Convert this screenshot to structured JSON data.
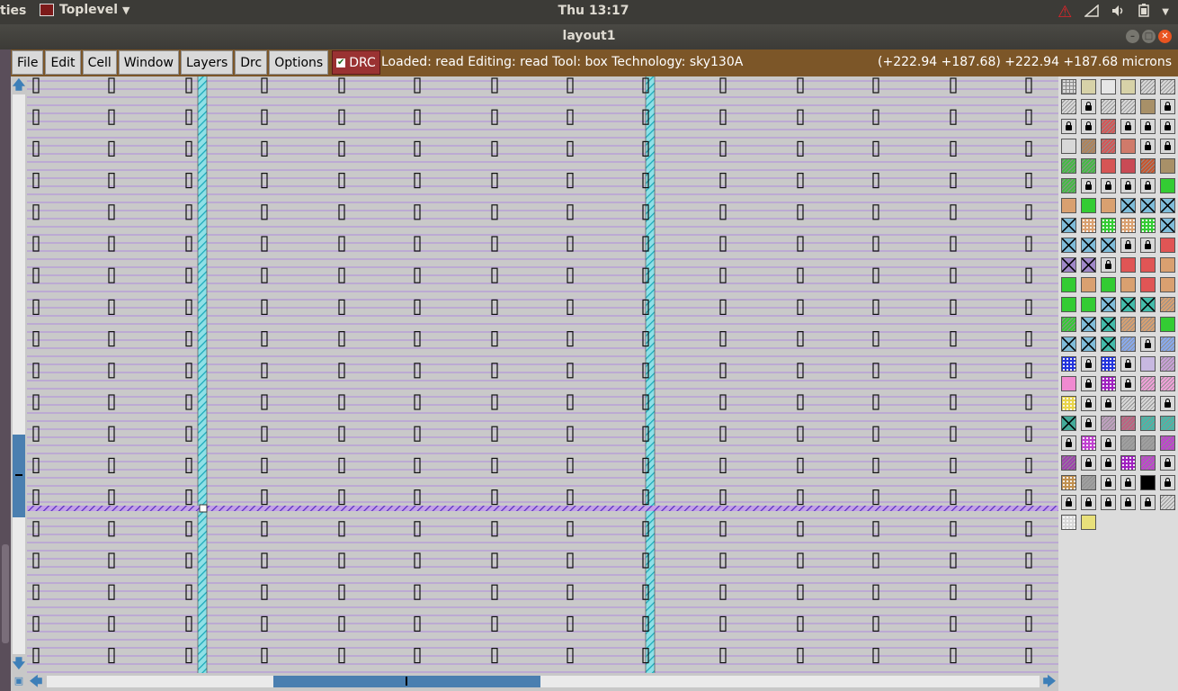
{
  "system_bar": {
    "activities": "ties",
    "app_name": "Toplevel",
    "clock": "Thu 13:17"
  },
  "window": {
    "title": "layout1"
  },
  "menu": {
    "items": [
      "File",
      "Edit",
      "Cell",
      "Window",
      "Layers",
      "Drc",
      "Options"
    ],
    "drc_label": "DRC",
    "drc_checked": true
  },
  "status": {
    "text": "Loaded: read Editing: read Tool: box  Technology: sky130A",
    "coords": "(+222.94 +187.68) +222.94 +187.68 microns"
  },
  "scroll": {
    "vertical_position": 0.64,
    "horizontal_position": 0.4
  },
  "colors": {
    "menubar": "#7c5628",
    "drc_button": "#9a3232",
    "canvas": "#c9c9c9",
    "stripe": "#b9a3d6",
    "via_column": "#29b5c4",
    "selection_line": "#7a3fd0",
    "scroll_thumb": "#4a7fb0"
  },
  "layers": [
    {
      "color": "#d8d8d8",
      "pattern": "grid"
    },
    {
      "color": "#d7d2a8"
    },
    {
      "color": "#e6e6e6",
      "pattern": "outline"
    },
    {
      "color": "#d7d2a8"
    },
    {
      "color": "#d8d8d8",
      "pattern": "hatch"
    },
    {
      "color": "#d8d8d8",
      "pattern": "hatch"
    },
    {
      "color": "#d8d8d8",
      "pattern": "hatch"
    },
    {
      "color": "#d8d8d8",
      "lock": true
    },
    {
      "color": "#d8d8d8",
      "pattern": "hatch"
    },
    {
      "color": "#d8d8d8",
      "pattern": "hatch"
    },
    {
      "color": "#a89068"
    },
    {
      "color": "#d8d8d8",
      "lock": true
    },
    {
      "color": "#d8d8d8",
      "lock": true
    },
    {
      "color": "#d8d8d8",
      "lock": true
    },
    {
      "color": "#d65555",
      "pattern": "hatch"
    },
    {
      "color": "#d8d8d8",
      "lock": true
    },
    {
      "color": "#d8d8d8",
      "lock": true
    },
    {
      "color": "#d8d8d8",
      "lock": true
    },
    {
      "color": "#d8d8d8"
    },
    {
      "color": "#b0845a",
      "pattern": "hatch"
    },
    {
      "color": "#d65555",
      "pattern": "hatch"
    },
    {
      "color": "#d07a6a"
    },
    {
      "color": "#d8d8d8",
      "lock": true
    },
    {
      "color": "#d8d8d8",
      "lock": true
    },
    {
      "color": "#44bb44",
      "pattern": "hatch"
    },
    {
      "color": "#44bb44",
      "pattern": "hatch"
    },
    {
      "color": "#d65555"
    },
    {
      "color": "#c94a55"
    },
    {
      "color": "#c9552d",
      "pattern": "hatch"
    },
    {
      "color": "#a89068"
    },
    {
      "color": "#44bb44",
      "pattern": "hatch"
    },
    {
      "color": "#d8d8d8",
      "lock": true
    },
    {
      "color": "#d8d8d8",
      "lock": true
    },
    {
      "color": "#d8d8d8",
      "lock": true
    },
    {
      "color": "#d8d8d8",
      "lock": true
    },
    {
      "color": "#33cc33"
    },
    {
      "color": "#d9a070"
    },
    {
      "color": "#33cc33"
    },
    {
      "color": "#d9a070"
    },
    {
      "color": "#7fbcd9",
      "pattern": "x"
    },
    {
      "color": "#7fbcd9",
      "pattern": "x"
    },
    {
      "color": "#7fbcd9",
      "pattern": "x"
    },
    {
      "color": "#7fbcd9",
      "pattern": "x"
    },
    {
      "color": "#d9a070",
      "pattern": "dots"
    },
    {
      "color": "#33cc33",
      "pattern": "dots"
    },
    {
      "color": "#d9a070",
      "pattern": "dots"
    },
    {
      "color": "#33cc33",
      "pattern": "dots"
    },
    {
      "color": "#7fbcd9",
      "pattern": "x"
    },
    {
      "color": "#7fbcd9",
      "pattern": "x"
    },
    {
      "color": "#7fbcd9",
      "pattern": "x"
    },
    {
      "color": "#7fbcd9",
      "pattern": "x"
    },
    {
      "color": "#d8d8d8",
      "lock": true
    },
    {
      "color": "#d8d8d8",
      "lock": true
    },
    {
      "color": "#e05555"
    },
    {
      "color": "#a088c8",
      "pattern": "x"
    },
    {
      "color": "#a088c8",
      "pattern": "x"
    },
    {
      "color": "#d8d8d8",
      "lock": true
    },
    {
      "color": "#e05555"
    },
    {
      "color": "#e05555"
    },
    {
      "color": "#d9a070"
    },
    {
      "color": "#33cc33"
    },
    {
      "color": "#d9a070"
    },
    {
      "color": "#33cc33"
    },
    {
      "color": "#d9a070"
    },
    {
      "color": "#e05555"
    },
    {
      "color": "#d9a070"
    },
    {
      "color": "#33cc33"
    },
    {
      "color": "#33cc33"
    },
    {
      "color": "#7fbcd9",
      "pattern": "x"
    },
    {
      "color": "#44bbaa",
      "pattern": "x"
    },
    {
      "color": "#44bbaa",
      "pattern": "x"
    },
    {
      "color": "#d9a070",
      "pattern": "hatch"
    },
    {
      "color": "#33cc33",
      "pattern": "hatch"
    },
    {
      "color": "#7fbcd9",
      "pattern": "x"
    },
    {
      "color": "#44bbaa",
      "pattern": "x"
    },
    {
      "color": "#d9a070",
      "pattern": "hatch"
    },
    {
      "color": "#d9a070",
      "pattern": "hatch"
    },
    {
      "color": "#33cc33"
    },
    {
      "color": "#7fbcd9",
      "pattern": "x"
    },
    {
      "color": "#7fbcd9",
      "pattern": "x"
    },
    {
      "color": "#44bbaa",
      "pattern": "x"
    },
    {
      "color": "#88aaee",
      "pattern": "hatch"
    },
    {
      "color": "#d8d8d8",
      "lock": true
    },
    {
      "color": "#88aaee",
      "pattern": "hatch"
    },
    {
      "color": "#2233dd",
      "pattern": "dots"
    },
    {
      "color": "#d8d8d8",
      "lock": true
    },
    {
      "color": "#2233dd",
      "pattern": "dots"
    },
    {
      "color": "#d8d8d8",
      "lock": true
    },
    {
      "color": "#c7b8e0"
    },
    {
      "color": "#c9a0d8",
      "pattern": "hatch"
    },
    {
      "color": "#f08ad0"
    },
    {
      "color": "#d8d8d8",
      "lock": true
    },
    {
      "color": "#a020c0",
      "pattern": "dots"
    },
    {
      "color": "#d8d8d8",
      "lock": true
    },
    {
      "color": "#f0a0d8",
      "pattern": "hatch"
    },
    {
      "color": "#f0a0d8",
      "pattern": "hatch"
    },
    {
      "color": "#e8d44a",
      "pattern": "dots"
    },
    {
      "color": "#d8d8d8",
      "lock": true
    },
    {
      "color": "#d8d8d8",
      "lock": true
    },
    {
      "color": "#d8d8d8",
      "pattern": "hatch"
    },
    {
      "color": "#d8d8d8",
      "pattern": "hatch"
    },
    {
      "color": "#d8d8d8",
      "lock": true
    },
    {
      "color": "#44aa99",
      "pattern": "x"
    },
    {
      "color": "#d8d8d8",
      "lock": true
    },
    {
      "color": "#c0a0c0",
      "pattern": "hatch"
    },
    {
      "color": "#c06080",
      "pattern": "hatch"
    },
    {
      "color": "#44bbaa",
      "pattern": "hatch"
    },
    {
      "color": "#44bbaa",
      "pattern": "hatch"
    },
    {
      "color": "#d8d8d8",
      "lock": true
    },
    {
      "color": "#c040d0",
      "pattern": "dots"
    },
    {
      "color": "#d8d8d8",
      "lock": true
    },
    {
      "color": "#a0a0a0",
      "pattern": "hatch"
    },
    {
      "color": "#a0a0a0",
      "pattern": "hatch"
    },
    {
      "color": "#c040d0",
      "pattern": "hatch"
    },
    {
      "color": "#a040b0",
      "pattern": "hatch"
    },
    {
      "color": "#d8d8d8",
      "lock": true
    },
    {
      "color": "#d8d8d8",
      "lock": true
    },
    {
      "color": "#a020c0",
      "pattern": "dots"
    },
    {
      "color": "#c040d0",
      "pattern": "hatch"
    },
    {
      "color": "#d8d8d8",
      "lock": true
    },
    {
      "color": "#c09050",
      "pattern": "dots"
    },
    {
      "color": "#a0a0a0",
      "pattern": "hatch"
    },
    {
      "color": "#d8d8d8",
      "lock": true
    },
    {
      "color": "#d8d8d8",
      "lock": true
    },
    {
      "color": "#000000"
    },
    {
      "color": "#d8d8d8",
      "lock": true
    },
    {
      "color": "#d8d8d8",
      "lock": true
    },
    {
      "color": "#d8d8d8",
      "lock": true
    },
    {
      "color": "#d8d8d8",
      "lock": true
    },
    {
      "color": "#d8d8d8",
      "lock": true
    },
    {
      "color": "#d8d8d8",
      "lock": true
    },
    {
      "color": "#d8d8d8",
      "pattern": "hatch"
    },
    {
      "color": "#d8d8d8",
      "pattern": "dots"
    },
    {
      "color": "#e8e07a"
    }
  ]
}
